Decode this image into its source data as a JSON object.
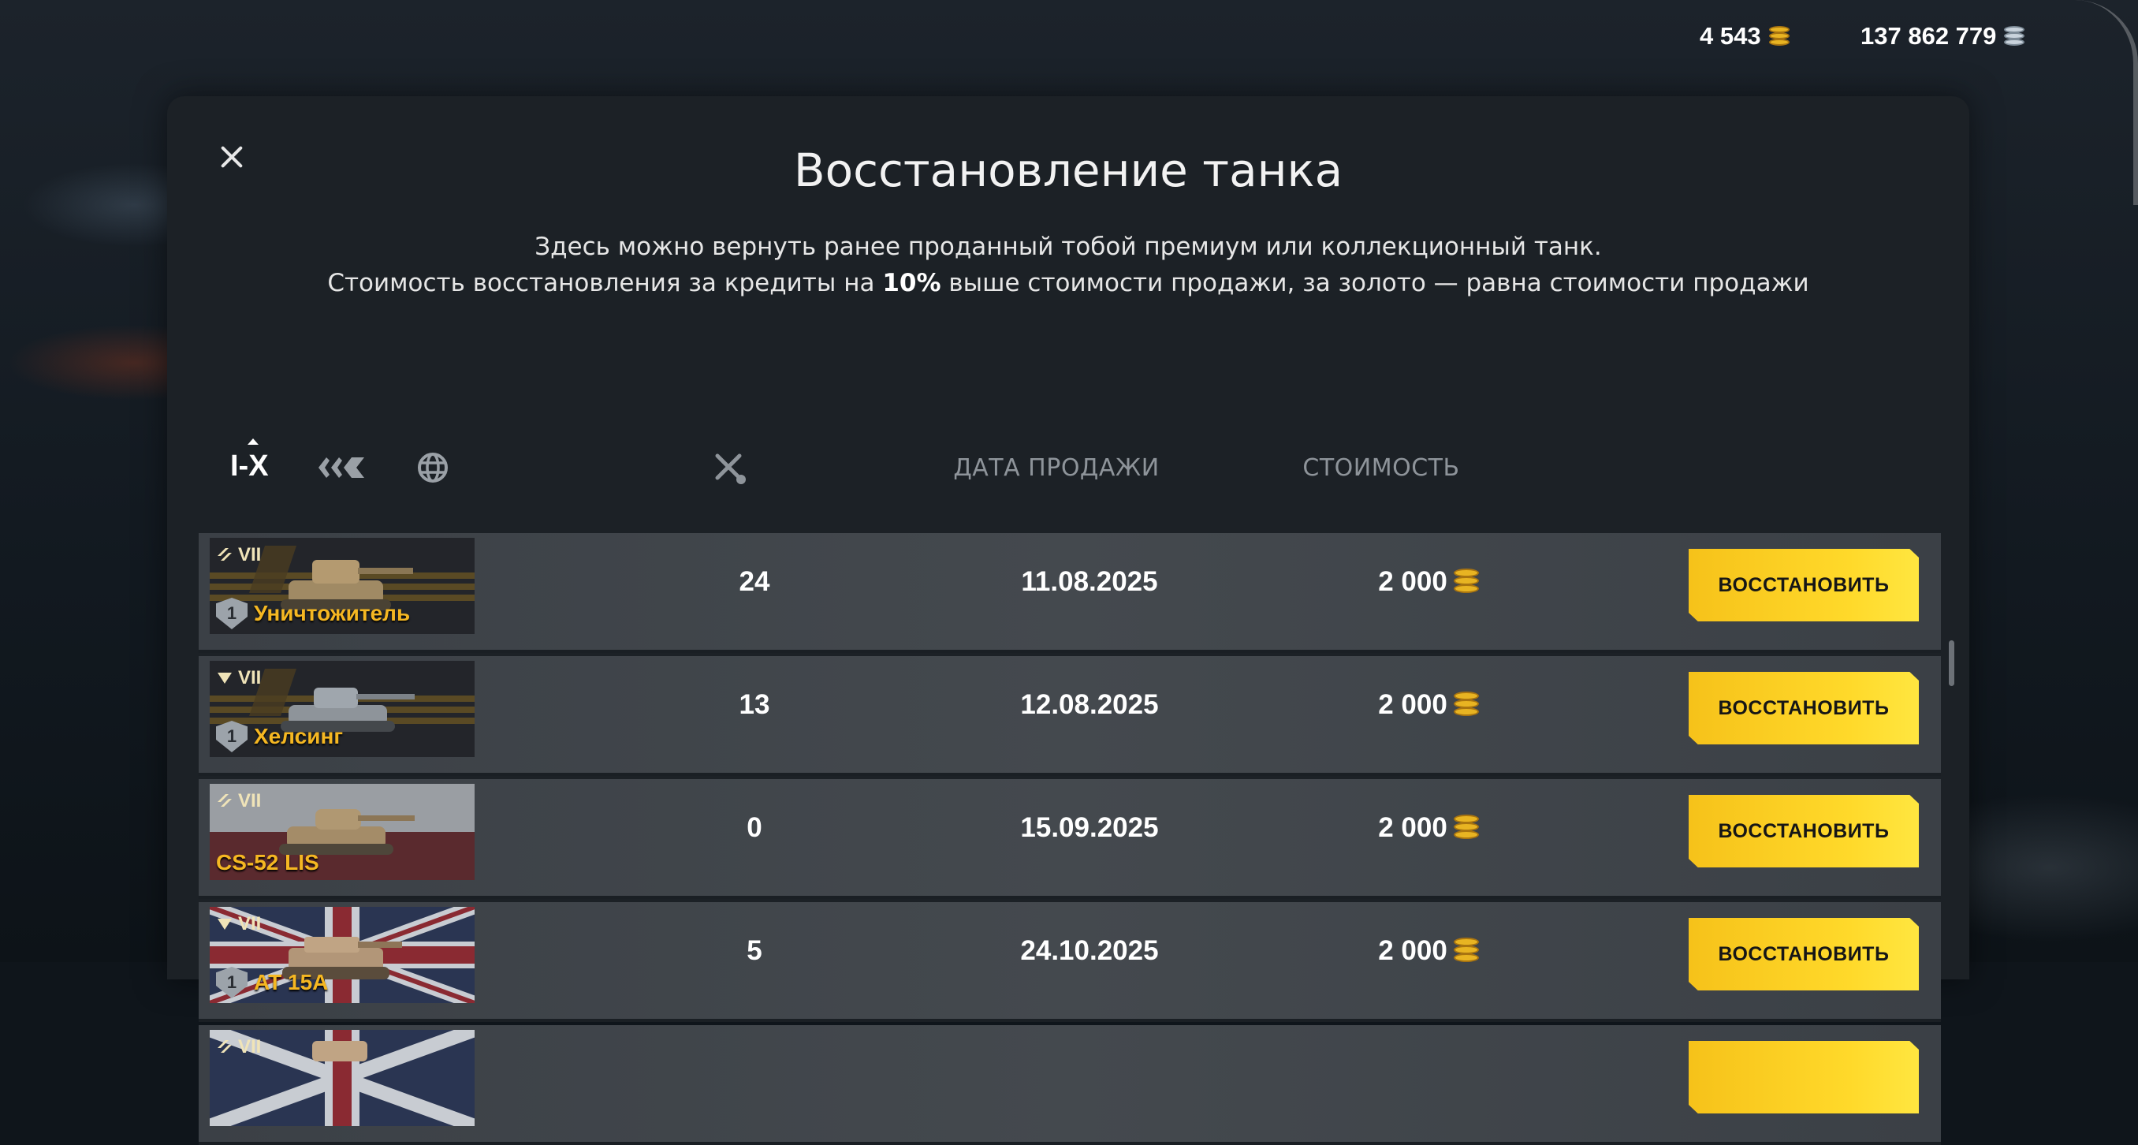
{
  "currency": {
    "gold": "4 543",
    "silver": "137 862 779"
  },
  "modal": {
    "title": "Восстановление танка",
    "description_line1": "Здесь можно вернуть ранее проданный тобой премиум или коллекционный танк.",
    "description_line2_pre": "Стоимость восстановления за кредиты на ",
    "description_line2_bold": "10%",
    "description_line2_post": " выше стоимости продажи, за золото — равна стоимости продажи"
  },
  "header": {
    "tier_sort": "I-X",
    "date_col": "ДАТА ПРОДАЖИ",
    "cost_col": "СТОИМОСТЬ",
    "icons": [
      "tank-type-icon",
      "nation-globe-icon",
      "battles-icon"
    ]
  },
  "rows": [
    {
      "tier": "VII",
      "type_icon": "td-icon",
      "name": "Уничтожитель",
      "mastery": "1",
      "battles": "24",
      "date": "11.08.2025",
      "cost": "2 000",
      "button": "ВОССТАНОВИТЬ",
      "bg": "striped-dark"
    },
    {
      "tier": "VII",
      "type_icon": "td-arrow-icon",
      "name": "Хелсинг",
      "mastery": "1",
      "battles": "13",
      "date": "12.08.2025",
      "cost": "2 000",
      "button": "ВОССТАНОВИТЬ",
      "bg": "striped-dark"
    },
    {
      "tier": "VII",
      "type_icon": "td-icon",
      "name": "CS-52 LIS",
      "mastery": "",
      "battles": "0",
      "date": "15.09.2025",
      "cost": "2 000",
      "button": "ВОССТАНОВИТЬ",
      "bg": "poland"
    },
    {
      "tier": "VII",
      "type_icon": "td-arrow-icon",
      "name": "AT 15A",
      "mastery": "1",
      "battles": "5",
      "date": "24.10.2025",
      "cost": "2 000",
      "button": "ВОССТАНОВИТЬ",
      "bg": "uk"
    },
    {
      "tier": "VII",
      "type_icon": "td-icon",
      "name": "",
      "mastery": "",
      "battles": "",
      "date": "",
      "cost": "",
      "button": "",
      "bg": "uk"
    }
  ],
  "colors": {
    "accent_gold": "#f5b722",
    "button_yellow": "#ffd92a",
    "panel": "#1c2126",
    "row": "#44494e"
  }
}
